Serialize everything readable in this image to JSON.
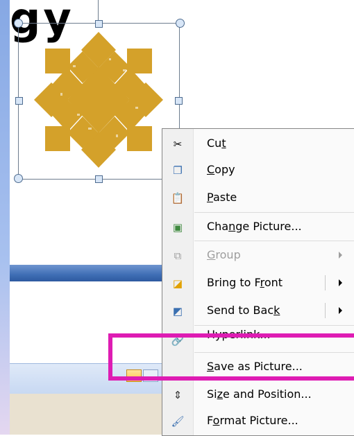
{
  "slide": {
    "title_fragment": "gy"
  },
  "context_menu": {
    "items": [
      {
        "label_pre": "Cu",
        "label_key": "t",
        "label_post": "",
        "icon": "scissors-icon",
        "enabled": true
      },
      {
        "label_pre": "",
        "label_key": "C",
        "label_post": "opy",
        "icon": "copy-icon",
        "enabled": true
      },
      {
        "label_pre": "",
        "label_key": "P",
        "label_post": "aste",
        "icon": "paste-icon",
        "enabled": true
      },
      {
        "label_pre": "Cha",
        "label_key": "n",
        "label_post": "ge Picture...",
        "icon": "change-picture-icon",
        "enabled": true
      },
      {
        "label_pre": "",
        "label_key": "G",
        "label_post": "roup",
        "icon": "group-icon",
        "enabled": false
      },
      {
        "label_pre": "Bring to F",
        "label_key": "r",
        "label_post": "ont",
        "icon": "bring-to-front-icon",
        "enabled": true
      },
      {
        "label_pre": "Send to Bac",
        "label_key": "k",
        "label_post": "",
        "icon": "send-to-back-icon",
        "enabled": true
      },
      {
        "label_pre": "Hyperlink...",
        "label_key": "",
        "label_post": "",
        "icon": "hyperlink-icon",
        "enabled": true
      },
      {
        "label_pre": "",
        "label_key": "S",
        "label_post": "ave as Picture...",
        "icon": "",
        "enabled": true
      },
      {
        "label_pre": "Si",
        "label_key": "z",
        "label_post": "e and Position...",
        "icon": "size-position-icon",
        "enabled": true
      },
      {
        "label_pre": "F",
        "label_key": "o",
        "label_post": "rmat Picture...",
        "icon": "format-picture-icon",
        "enabled": true
      }
    ]
  },
  "colors": {
    "logo_gold": "#d4a12a",
    "highlight": "#de1cb3"
  }
}
